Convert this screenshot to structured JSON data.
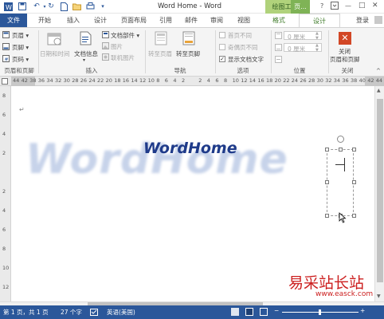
{
  "titlebar": {
    "title": "Word Home - Word",
    "help": "?",
    "minimize": "—",
    "maximize": "□",
    "close": "✕"
  },
  "tabs": {
    "file": "文件",
    "home": "开始",
    "insert": "插入",
    "design": "设计",
    "layout": "页面布局",
    "references": "引用",
    "mailings": "邮件",
    "review": "审阅",
    "view": "视图",
    "format": "格式",
    "design2": "设计",
    "login": "登录",
    "drawing_tools": "绘图工具",
    "hf_tools": "页..."
  },
  "ribbon": {
    "header": "页眉",
    "footer": "页脚",
    "pagenum": "页码",
    "datetime": "日期和时间",
    "docinfo": "文档信息",
    "docparts": "文档部件",
    "picture": "图片",
    "onlinepic": "联机图片",
    "goto_header": "转至页眉",
    "goto_footer": "转至页脚",
    "diff_first": "首页不同",
    "diff_oddeven": "奇偶页不同",
    "show_doctext": "显示文档文字",
    "header_pos": "0 厘米",
    "footer_pos": "0 厘米",
    "close_label_1": "关闭",
    "close_label_2": "页眉和页脚",
    "groups": {
      "hf": "页眉和页脚",
      "insert": "插入",
      "nav": "导航",
      "options": "选项",
      "position": "位置",
      "close": "关闭"
    }
  },
  "ruler": {
    "numbers": [
      "44",
      "42",
      "38",
      "36",
      "34",
      "32",
      "30",
      "28",
      "26",
      "24",
      "22",
      "20",
      "18",
      "16",
      "14",
      "12",
      "10",
      "8",
      "6",
      "4",
      "2",
      "",
      "2",
      "4",
      "6",
      "8",
      "10",
      "12",
      "14",
      "16",
      "18",
      "20",
      "22",
      "24",
      "26",
      "28",
      "30",
      "32",
      "34",
      "36",
      "38",
      "40",
      "42",
      "44"
    ]
  },
  "vruler": {
    "numbers": [
      "8",
      "6",
      "4",
      "2",
      "",
      "2",
      "4",
      "6",
      "8",
      "10",
      "12"
    ]
  },
  "document": {
    "para_mark": "↵",
    "wordart": "WordHome",
    "watermark": "WordHome"
  },
  "status": {
    "page": "第 1 页，共 1 页",
    "words": "27 个字",
    "language": "英语(美国)"
  },
  "site_watermark": {
    "cn": "易采站长站",
    "url": "www.easck.com"
  },
  "colors": {
    "accent": "#2b579a",
    "tab_context": "#b0d27b",
    "close_red": "#d24726"
  }
}
